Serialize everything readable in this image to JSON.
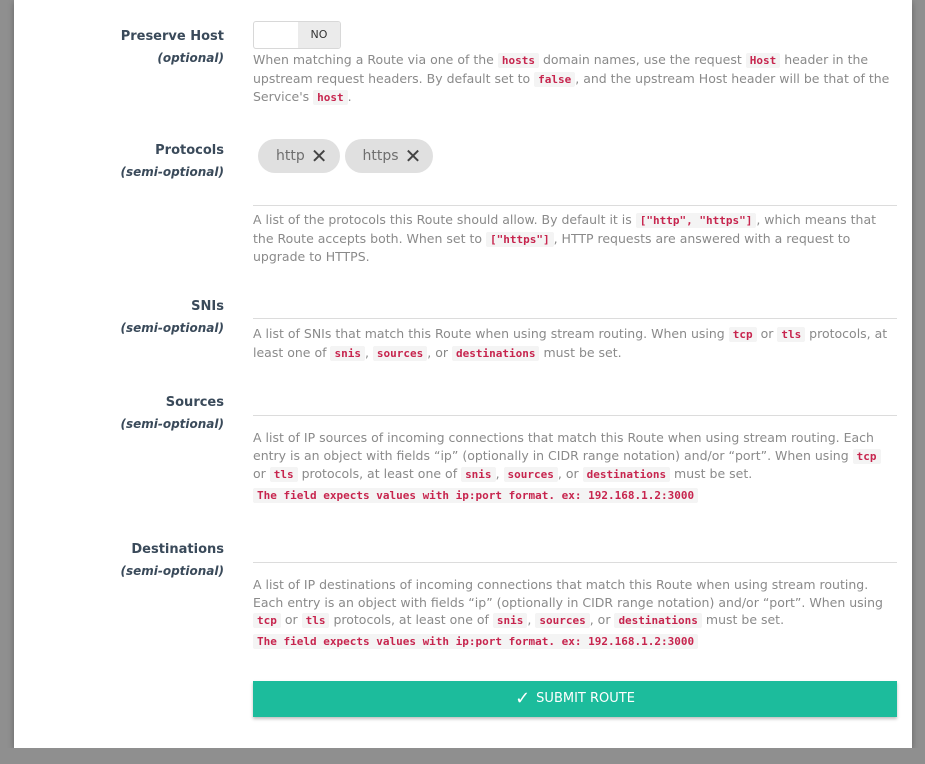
{
  "preserve_host": {
    "label": "Preserve Host",
    "sub": "(optional)",
    "toggle_value": "NO",
    "help": [
      {
        "t": "When matching a Route via one of the "
      },
      {
        "c": "hosts"
      },
      {
        "t": " domain names, use the request "
      },
      {
        "c": "Host"
      },
      {
        "t": " header in the upstream request headers. By default set to "
      },
      {
        "c": "false"
      },
      {
        "t": ", and the upstream Host header will be that of the Service's "
      },
      {
        "c": "host"
      },
      {
        "t": "."
      }
    ]
  },
  "protocols": {
    "label": "Protocols",
    "sub": "(semi-optional)",
    "chips": [
      "http",
      "https"
    ],
    "help": [
      {
        "t": "A list of the protocols this Route should allow. By default it is "
      },
      {
        "c": "[\"http\", \"https\"]"
      },
      {
        "t": ", which means that the Route accepts both. When set to "
      },
      {
        "c": "[\"https\"]"
      },
      {
        "t": ", HTTP requests are answered with a request to upgrade to HTTPS."
      }
    ]
  },
  "snis": {
    "label": "SNIs",
    "sub": "(semi-optional)",
    "help": [
      {
        "t": "A list of SNIs that match this Route when using stream routing. When using "
      },
      {
        "c": "tcp"
      },
      {
        "t": " or "
      },
      {
        "c": "tls"
      },
      {
        "t": " protocols, at least one of "
      },
      {
        "c": "snis"
      },
      {
        "t": ", "
      },
      {
        "c": "sources"
      },
      {
        "t": ", or "
      },
      {
        "c": "destinations"
      },
      {
        "t": " must be set."
      }
    ]
  },
  "sources": {
    "label": "Sources",
    "sub": "(semi-optional)",
    "help": [
      {
        "t": "A list of IP sources of incoming connections that match this Route when using stream routing. Each entry is an object with fields “ip” (optionally in CIDR range notation) and/or “port”. When using "
      },
      {
        "c": "tcp"
      },
      {
        "t": " or "
      },
      {
        "c": "tls"
      },
      {
        "t": " protocols, at least one of "
      },
      {
        "c": "snis"
      },
      {
        "t": ", "
      },
      {
        "c": "sources"
      },
      {
        "t": ", or "
      },
      {
        "c": "destinations"
      },
      {
        "t": " must be set."
      }
    ],
    "format_note": "The field expects values with ip:port format. ex: 192.168.1.2:3000"
  },
  "destinations": {
    "label": "Destinations",
    "sub": "(semi-optional)",
    "help": [
      {
        "t": "A list of IP destinations of incoming connections that match this Route when using stream routing. Each entry is an object with fields “ip” (optionally in CIDR range notation) and/or “port”. When using "
      },
      {
        "c": "tcp"
      },
      {
        "t": " or "
      },
      {
        "c": "tls"
      },
      {
        "t": " protocols, at least one of "
      },
      {
        "c": "snis"
      },
      {
        "t": ", "
      },
      {
        "c": "sources"
      },
      {
        "t": ", or "
      },
      {
        "c": "destinations"
      },
      {
        "t": " must be set."
      }
    ],
    "format_note": "The field expects values with ip:port format. ex: 192.168.1.2:3000"
  },
  "submit": {
    "label": "SUBMIT ROUTE",
    "icon": "check-icon"
  }
}
